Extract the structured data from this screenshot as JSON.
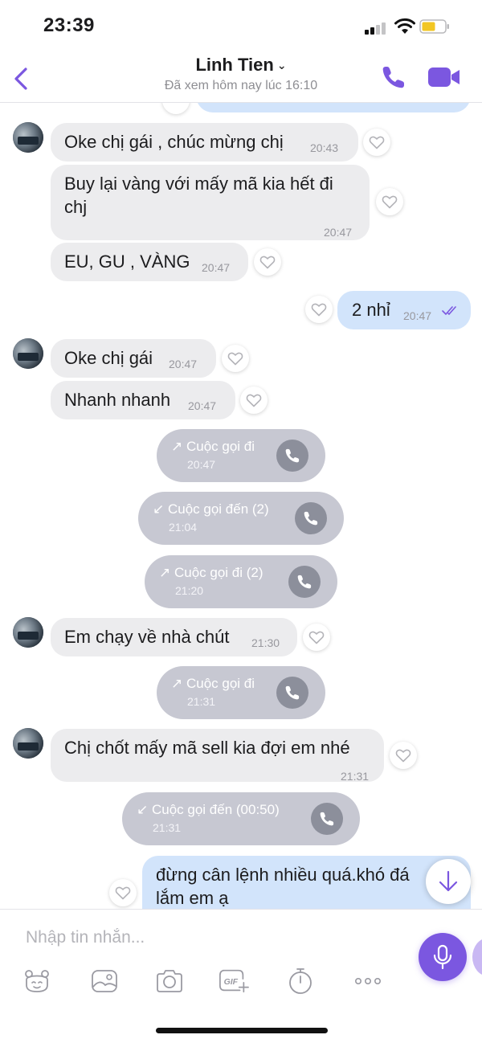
{
  "status_bar": {
    "time": "23:39"
  },
  "header": {
    "contact_name": "Linh Tien",
    "chevron": "⌄",
    "last_seen": "Đã xem hôm nay lúc 16:10",
    "icons": {
      "back": "chevron-left-icon",
      "call": "phone-icon",
      "video": "video-camera-icon"
    },
    "accent_color": "#7b57e0"
  },
  "messages": {
    "m1": {
      "text": "Oke chị gái , chúc mừng chị",
      "time": "20:43"
    },
    "m2": {
      "line1": "Buy lại vàng với mấy mã kia hết đi",
      "line2": "chj",
      "time": "20:47"
    },
    "m3": {
      "text": "EU, GU , VÀNG",
      "time": "20:47"
    },
    "m4": {
      "text": "2 nhỉ",
      "time": "20:47"
    },
    "m5": {
      "text": "Oke chị gái",
      "time": "20:47"
    },
    "m6": {
      "text": "Nhanh nhanh",
      "time": "20:47"
    },
    "c1": {
      "arrow": "↗",
      "label": "Cuộc gọi đi",
      "time": "20:47"
    },
    "c2": {
      "arrow": "↙",
      "label": "Cuộc gọi đến (2)",
      "time": "21:04"
    },
    "c3": {
      "arrow": "↗",
      "label": "Cuộc gọi đi (2)",
      "time": "21:20"
    },
    "m7": {
      "text": "Em chạy về nhà chút",
      "time": "21:30"
    },
    "c4": {
      "arrow": "↗",
      "label": "Cuộc gọi đi",
      "time": "21:31"
    },
    "m8": {
      "text": "Chị chốt mấy mã sell kia đợi em nhé",
      "time": "21:31"
    },
    "c5": {
      "arrow": "↙",
      "label": "Cuộc gọi đến (00:50)",
      "time": "21:31"
    },
    "m9": {
      "line1": "đừng cân lệnh nhiều quá.khó đá",
      "line2": "lắm em ạ"
    }
  },
  "composer": {
    "placeholder": "Nhập tin nhắn...",
    "toolbar_icons": [
      "sticker-icon",
      "gallery-icon",
      "camera-icon",
      "gif-icon",
      "timer-icon",
      "more-icon"
    ],
    "send_icon": "microphone-icon"
  },
  "colors": {
    "incoming_bubble": "#ececee",
    "outgoing_bubble": "#d2e4fb",
    "call_bubble": "#c7c8d2",
    "read_ticks": "#7b57e0"
  }
}
